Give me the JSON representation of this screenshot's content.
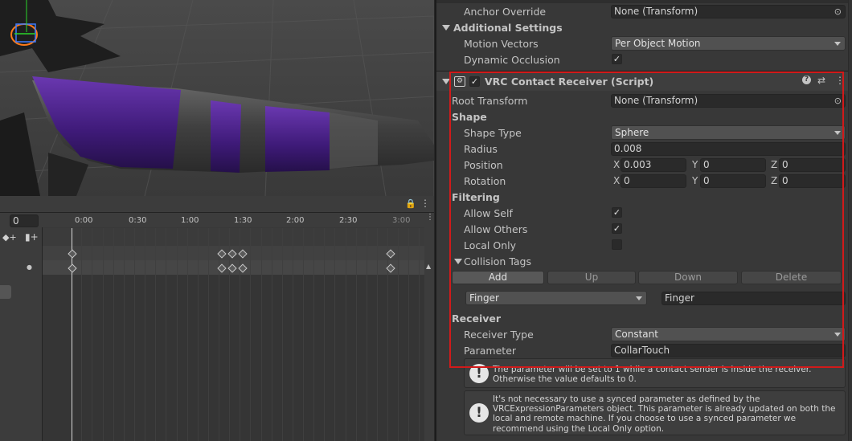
{
  "timeline": {
    "frame_value": "0",
    "ticks": [
      "0:00",
      "0:30",
      "1:00",
      "1:30",
      "2:00",
      "2:30",
      "3:00"
    ]
  },
  "inspector": {
    "anchor_override": {
      "label": "Anchor Override",
      "value": "None (Transform)"
    },
    "additional_settings": {
      "title": "Additional Settings",
      "motion_vectors": {
        "label": "Motion Vectors",
        "value": "Per Object Motion"
      },
      "dynamic_occlusion": {
        "label": "Dynamic Occlusion",
        "checked": true
      }
    },
    "component": {
      "title": "VRC Contact Receiver (Script)",
      "root_transform": {
        "label": "Root Transform",
        "value": "None (Transform)"
      },
      "shape_header": "Shape",
      "shape_type": {
        "label": "Shape Type",
        "value": "Sphere"
      },
      "radius": {
        "label": "Radius",
        "value": "0.008"
      },
      "position": {
        "label": "Position",
        "x": "0.003",
        "y": "0",
        "z": "0"
      },
      "rotation": {
        "label": "Rotation",
        "x": "0",
        "y": "0",
        "z": "0"
      },
      "axis_labels": {
        "x": "X",
        "y": "Y",
        "z": "Z"
      },
      "filtering_header": "Filtering",
      "allow_self": {
        "label": "Allow Self",
        "checked": true
      },
      "allow_others": {
        "label": "Allow Others",
        "checked": true
      },
      "local_only": {
        "label": "Local Only",
        "checked": false
      },
      "collision_tags": {
        "label": "Collision Tags",
        "buttons": {
          "add": "Add",
          "up": "Up",
          "down": "Down",
          "delete": "Delete"
        },
        "tag_dropdown": "Finger",
        "tag_value": "Finger"
      },
      "receiver_header": "Receiver",
      "receiver_type": {
        "label": "Receiver Type",
        "value": "Constant"
      },
      "parameter": {
        "label": "Parameter",
        "value": "CollarTouch"
      }
    },
    "help1": "The parameter will be set to 1 while a contact sender is inside the receiver.  Otherwise the value defaults to 0.",
    "help2": "It's not necessary to use a synced parameter as defined by the VRCExpressionParameters object.  This parameter is already updated on both the local and remote machine.  If you choose to use a synced parameter we recommend using the Local Only option."
  },
  "colors": {
    "highlight": "#d11a1a",
    "accent_purple": "#5a2a9a"
  }
}
